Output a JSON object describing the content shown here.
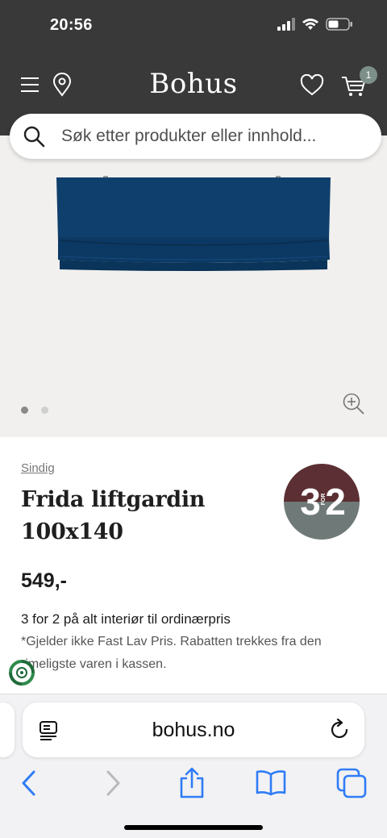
{
  "status_bar": {
    "time": "20:56"
  },
  "header": {
    "brand": "Bohus",
    "cart_count": "1"
  },
  "search": {
    "placeholder": "Søk etter produkter eller innhold..."
  },
  "product": {
    "brand": "Sindig",
    "title": "Frida liftgardin 100x140",
    "price": "549,-",
    "campaign_badge": {
      "top": "3",
      "mid": "FOR",
      "bottom": "2",
      "top_color": "#5b2f33",
      "bottom_color": "#6f7a78"
    },
    "offer_title": "3 for 2 på alt interiør til ordinærpris",
    "offer_note": "*Gjelder ikke Fast Lav Pris. Rabatten trekkes fra den rimeligste varen i kassen.",
    "image_dots": 2,
    "active_dot": 1
  },
  "browser": {
    "url": "bohus.no"
  },
  "colors": {
    "header_bg": "#393939",
    "gallery_bg": "#f1f0ee",
    "ios_blue": "#2f7cf6",
    "blind_blue": "#0d3f6e"
  }
}
